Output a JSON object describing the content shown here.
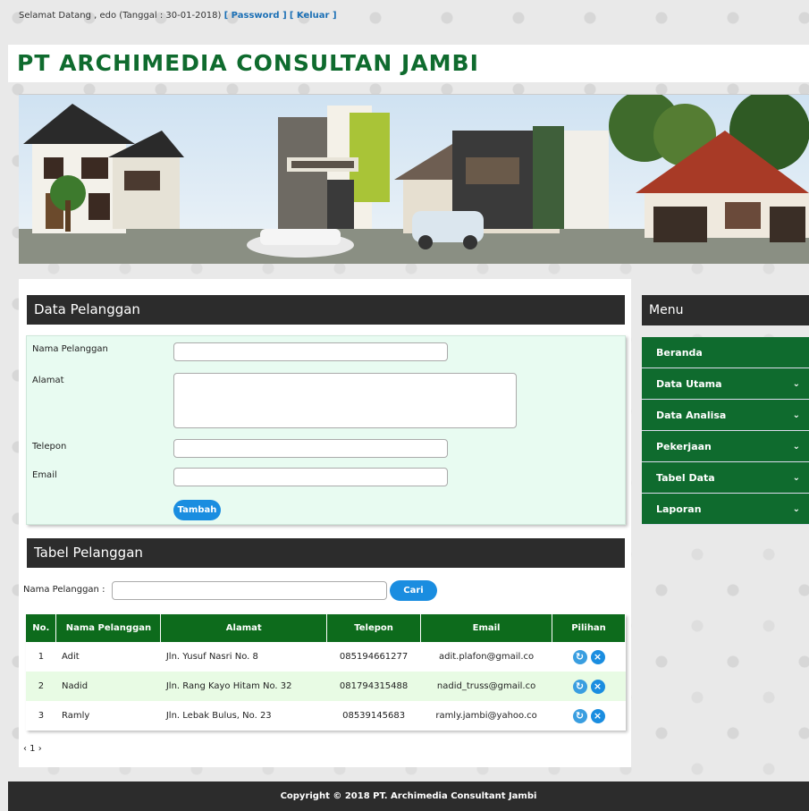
{
  "topbar": {
    "welcome": "Selamat Datang , edo (Tanggal : 30-01-2018)",
    "password_link": "[ Password ]",
    "logout_link": "[ Keluar ]"
  },
  "brand": {
    "title": "PT ARCHIMEDIA CONSULTAN JAMBI"
  },
  "form": {
    "heading": "Data Pelanggan",
    "name_label": "Nama Pelanggan",
    "address_label": "Alamat",
    "phone_label": "Telepon",
    "email_label": "Email",
    "name_value": "",
    "address_value": "",
    "phone_value": "",
    "email_value": "",
    "submit_label": "Tambah"
  },
  "table_section": {
    "heading": "Tabel Pelanggan",
    "search_label": "Nama Pelanggan :",
    "search_value": "",
    "search_button": "Cari",
    "columns": [
      "No.",
      "Nama Pelanggan",
      "Alamat",
      "Telepon",
      "Email",
      "Pilihan"
    ],
    "rows": [
      {
        "no": "1",
        "name": "Adit",
        "address": "Jln. Yusuf Nasri No. 8",
        "phone": "085194661277",
        "email": "adit.plafon@gmail.co"
      },
      {
        "no": "2",
        "name": "Nadid",
        "address": "Jln. Rang Kayo Hitam No. 32",
        "phone": "081794315488",
        "email": "nadid_truss@gmail.co"
      },
      {
        "no": "3",
        "name": "Ramly",
        "address": "Jln. Lebak Bulus, No. 23",
        "phone": "08539145683",
        "email": "ramly.jambi@yahoo.co"
      }
    ],
    "pager": "‹ 1 ›"
  },
  "menu": {
    "heading": "Menu",
    "items": [
      {
        "label": "Beranda",
        "chevron": ""
      },
      {
        "label": "Data Utama",
        "chevron": "⌄"
      },
      {
        "label": "Data Analisa",
        "chevron": "⌄"
      },
      {
        "label": "Pekerjaan",
        "chevron": "⌄"
      },
      {
        "label": "Tabel Data",
        "chevron": "⌄"
      },
      {
        "label": "Laporan",
        "chevron": "⌄"
      }
    ]
  },
  "footer": {
    "text": "Copyright © 2018 PT. Archimedia Consultant Jambi"
  },
  "colors": {
    "brand_green": "#0f6b2e",
    "header_dark": "#2c2c2c",
    "button_blue": "#1a8de0",
    "form_bg": "#e8fbf1"
  },
  "icons": {
    "edit": "refresh-icon",
    "delete": "close-icon",
    "chevron": "chevron-down-icon"
  }
}
